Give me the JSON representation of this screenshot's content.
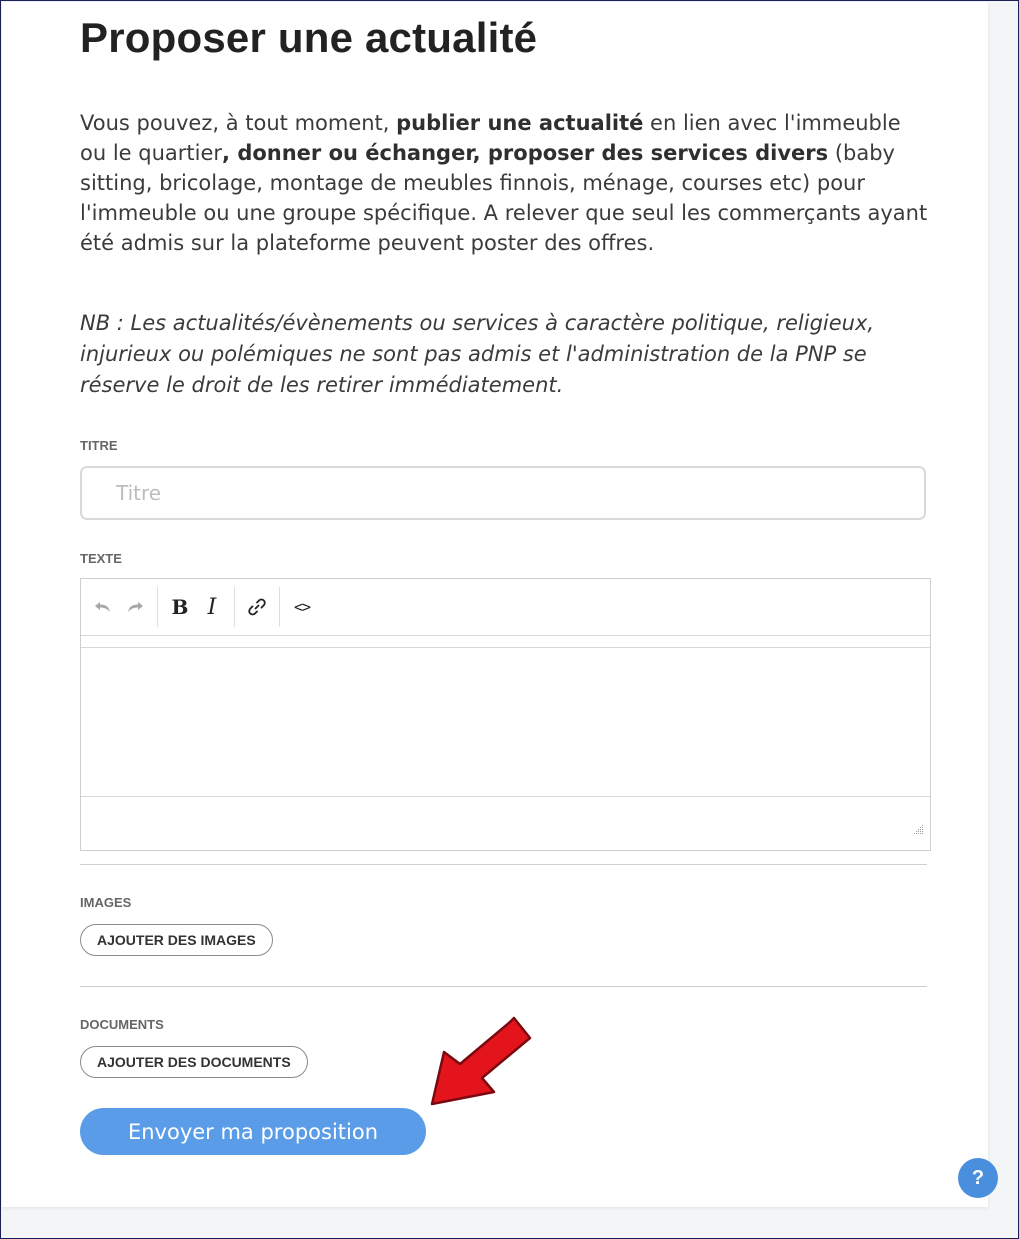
{
  "page": {
    "title": "Proposer une actualité",
    "intro": {
      "t1": "Vous pouvez, à tout moment, ",
      "b1": "publier une actualité",
      "t2": " en lien avec l'immeuble ou le quartier",
      "b2": ", donner ou échanger, proposer des services divers",
      "t3": " (baby sitting, bricolage, montage de meubles finnois, ménage, courses etc) pour l'immeuble ou une groupe spécifique. A relever que seul les commerçants ayant été admis sur la plateforme peuvent poster des offres."
    },
    "note": "NB : Les actualités/évènements ou services à caractère politique, religieux, injurieux ou polémiques ne sont pas admis et l'administration de la PNP se réserve le droit de les retirer immédiatement."
  },
  "form": {
    "title_label": "TITRE",
    "title_placeholder": "Titre",
    "title_value": "",
    "text_label": "TEXTE",
    "toolbar": {
      "undo_icon": "undo-icon",
      "redo_icon": "redo-icon",
      "bold_glyph": "B",
      "italic_glyph": "I",
      "link_icon": "link-icon",
      "code_glyph": "<>"
    },
    "images_label": "IMAGES",
    "add_images_label": "AJOUTER DES IMAGES",
    "documents_label": "DOCUMENTS",
    "add_documents_label": "AJOUTER DES DOCUMENTS",
    "submit_label": "Envoyer ma proposition"
  },
  "help": {
    "label": "?"
  },
  "colors": {
    "accent": "#5a9ce8",
    "arrow": "#e4141c",
    "help": "#4a8fdd"
  }
}
